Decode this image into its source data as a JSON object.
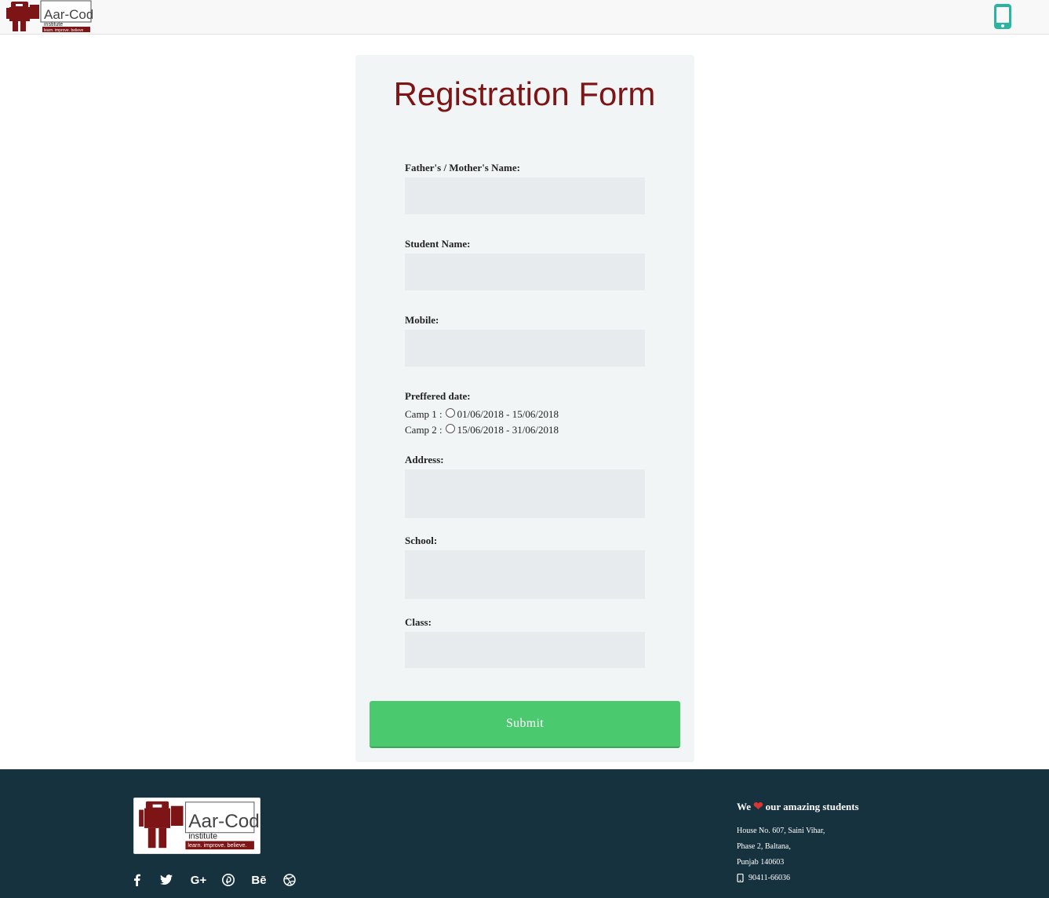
{
  "header": {
    "logo": {
      "brand": "Aar-Codes",
      "sub": "institute",
      "tagline": "learn. improve. believe"
    },
    "phone_icon": "mobile-phone-icon"
  },
  "form": {
    "title": "Registration Form",
    "fields": {
      "parent_name": {
        "label": "Father's / Mother's Name:",
        "value": ""
      },
      "student_name": {
        "label": "Student Name:",
        "value": ""
      },
      "mobile": {
        "label": "Mobile:",
        "value": ""
      },
      "address": {
        "label": "Address:",
        "value": ""
      },
      "school": {
        "label": "School:",
        "value": ""
      },
      "class": {
        "label": "Class:",
        "value": ""
      }
    },
    "preferred_date": {
      "label": "Preffered date:",
      "options": [
        {
          "prefix": "Camp 1 :",
          "range": "01/06/2018 - 15/06/2018"
        },
        {
          "prefix": "Camp 2 :",
          "range": "15/06/2018 - 31/06/2018"
        }
      ]
    },
    "submit_label": "Submit"
  },
  "footer": {
    "logo": {
      "brand": "Aar-Codes",
      "sub": "institute",
      "tagline": "learn. improve. believe."
    },
    "social": [
      "facebook-icon",
      "twitter-icon",
      "google-plus-icon",
      "pinterest-icon",
      "behance-icon",
      "dribbble-icon"
    ],
    "social_text": {
      "google": "G+",
      "behance": "Bē"
    },
    "love": {
      "pre": "We",
      "post": "our amazing students"
    },
    "address": [
      "House No. 607, Saini Vihar,",
      "Phase 2, Baltana,",
      "Punjab 140603"
    ],
    "phone": "90411-66036"
  },
  "colors": {
    "brand": "#7d1416",
    "submit": "#4ac96f",
    "footer_bg": "#17323f",
    "accent_phone": "#2bb5a0"
  }
}
